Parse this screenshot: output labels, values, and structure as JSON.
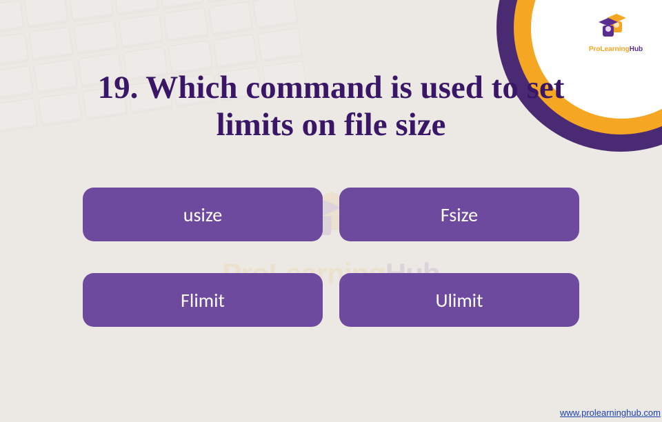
{
  "question": "19. Which command is used to set limits on file size",
  "answers": [
    "usize",
    "Fsize",
    "Flimit",
    "Ulimit"
  ],
  "logo": {
    "brand": "ProLearning",
    "suffix": "Hub"
  },
  "footer": {
    "url": "www.prolearninghub.com"
  },
  "colors": {
    "purple": "#4a2a72",
    "orange": "#f5a623",
    "pill": "#6d4a9e",
    "heading": "#3a1766"
  }
}
